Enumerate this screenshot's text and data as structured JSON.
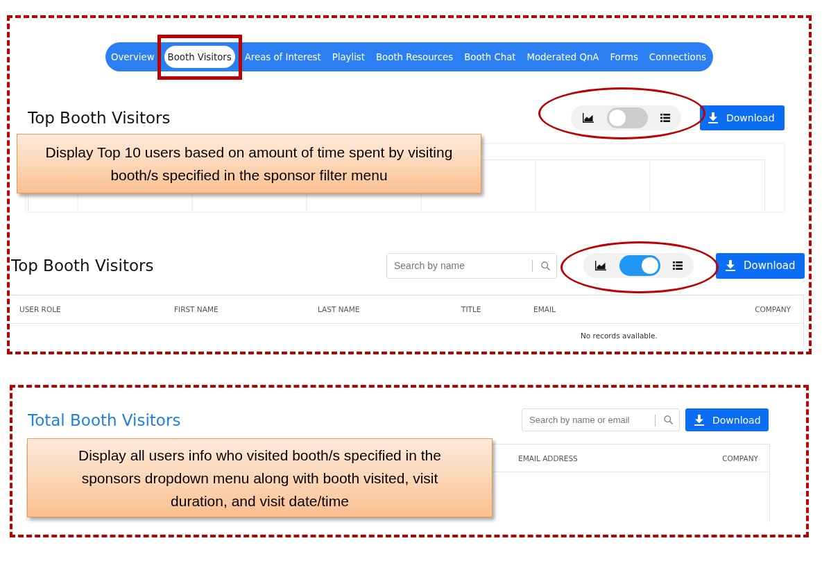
{
  "nav": {
    "tabs": [
      {
        "label": "Overview",
        "selected": false
      },
      {
        "label": "Booth Visitors",
        "selected": true
      },
      {
        "label": "Areas of Interest",
        "selected": false
      },
      {
        "label": "Playlist",
        "selected": false
      },
      {
        "label": "Booth Resources",
        "selected": false
      },
      {
        "label": "Booth Chat",
        "selected": false
      },
      {
        "label": "Moderated QnA",
        "selected": false
      },
      {
        "label": "Forms",
        "selected": false
      },
      {
        "label": "Connections",
        "selected": false
      }
    ]
  },
  "top_visitors_chart_view": {
    "title": "Top Booth Visitors",
    "view_toggle": {
      "on": false
    },
    "download_button": "Download",
    "callout": "Display Top 10 users based on amount of time spent by visiting booth/s specified in the sponsor filter menu"
  },
  "top_visitors_table_view": {
    "title": "Top Booth Visitors",
    "search": {
      "placeholder": "Search by name"
    },
    "view_toggle": {
      "on": true
    },
    "download_button": "Download",
    "columns": [
      "USER ROLE",
      "FIRST NAME",
      "LAST NAME",
      "TITLE",
      "EMAIL",
      "COMPANY"
    ],
    "empty_message": "No records available."
  },
  "total_booth_visitors": {
    "title": "Total Booth Visitors",
    "search": {
      "placeholder": "Search by name or email"
    },
    "download_button": "Download",
    "columns": [
      "EMAIL ADDRESS",
      "COMPANY"
    ],
    "callout": "Display all users info who visited booth/s specified in the sponsors dropdown menu along with booth visited, visit duration, and visit date/time"
  }
}
